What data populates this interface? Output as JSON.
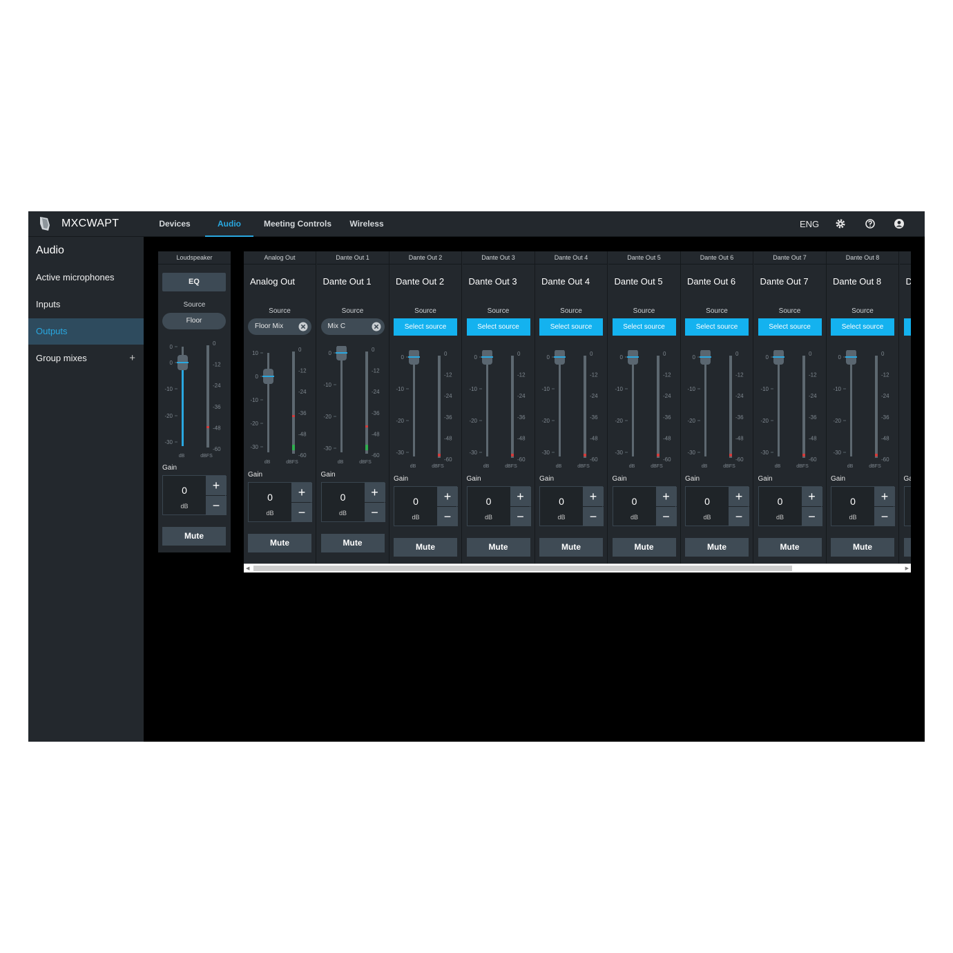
{
  "app": {
    "brand": "MXCWAPT",
    "language": "ENG"
  },
  "nav": {
    "tabs": [
      {
        "label": "Devices",
        "active": false
      },
      {
        "label": "Audio",
        "active": true
      },
      {
        "label": "Meeting Controls",
        "active": false
      },
      {
        "label": "Wireless",
        "active": false
      }
    ]
  },
  "toolbar_icons": [
    "gear-icon",
    "help-icon",
    "user-icon"
  ],
  "sidebar": {
    "title": "Audio",
    "items": [
      {
        "label": "Active microphones",
        "active": false
      },
      {
        "label": "Inputs",
        "active": false
      },
      {
        "label": "Outputs",
        "active": true
      },
      {
        "label": "Group mixes",
        "active": false,
        "plus": "+"
      }
    ]
  },
  "loudspeaker": {
    "title": "Loudspeaker",
    "eq_label": "EQ",
    "source_label": "Source",
    "source_value": "Floor",
    "gain_label": "Gain",
    "gain_value": "0",
    "gain_unit": "dB",
    "mute_label": "Mute",
    "fader_scale": [
      "0",
      "0",
      "-10",
      "-20",
      "-30"
    ],
    "meter_scale": [
      "0",
      "-12",
      "-24",
      "-36",
      "-48",
      "-60"
    ],
    "fader_unit": "dB",
    "meter_unit": "dBFS"
  },
  "outputs": [
    {
      "title": "Analog Out",
      "name": "Analog Out",
      "source": "Floor Mix",
      "source_selected": true,
      "gain": "0"
    },
    {
      "title": "Dante Out 1",
      "name": "Dante Out 1",
      "source": "Mix C",
      "source_selected": true,
      "gain": "0"
    },
    {
      "title": "Dante Out 2",
      "name": "Dante Out 2",
      "source": "Select source",
      "source_selected": false,
      "gain": "0"
    },
    {
      "title": "Dante Out 3",
      "name": "Dante Out 3",
      "source": "Select source",
      "source_selected": false,
      "gain": "0"
    },
    {
      "title": "Dante Out 4",
      "name": "Dante Out 4",
      "source": "Select source",
      "source_selected": false,
      "gain": "0"
    },
    {
      "title": "Dante Out 5",
      "name": "Dante Out 5",
      "source": "Select source",
      "source_selected": false,
      "gain": "0"
    },
    {
      "title": "Dante Out 6",
      "name": "Dante Out 6",
      "source": "Select source",
      "source_selected": false,
      "gain": "0"
    },
    {
      "title": "Dante Out 7",
      "name": "Dante Out 7",
      "source": "Select source",
      "source_selected": false,
      "gain": "0"
    },
    {
      "title": "Dante Out 8",
      "name": "Dante Out 8",
      "source": "Select source",
      "source_selected": false,
      "gain": "0"
    }
  ],
  "partial_strip": {
    "name": "D",
    "gain_label": "Ga"
  },
  "strip_labels": {
    "source": "Source",
    "gain": "Gain",
    "unit": "dB",
    "mute": "Mute",
    "fader_scale": [
      "10",
      "0",
      "-10",
      "-20",
      "-30"
    ],
    "fader_scale_short": [
      "0",
      "-10",
      "-20",
      "-30"
    ],
    "meter_scale": [
      "0",
      "-12",
      "-24",
      "-36",
      "-48",
      "-60"
    ],
    "fader_unit": "dB",
    "meter_unit": "dBFS"
  },
  "colors": {
    "accent": "#29a8e0",
    "select_source": "#14b2ef",
    "panel": "#23282d",
    "button": "#3f4b55"
  }
}
